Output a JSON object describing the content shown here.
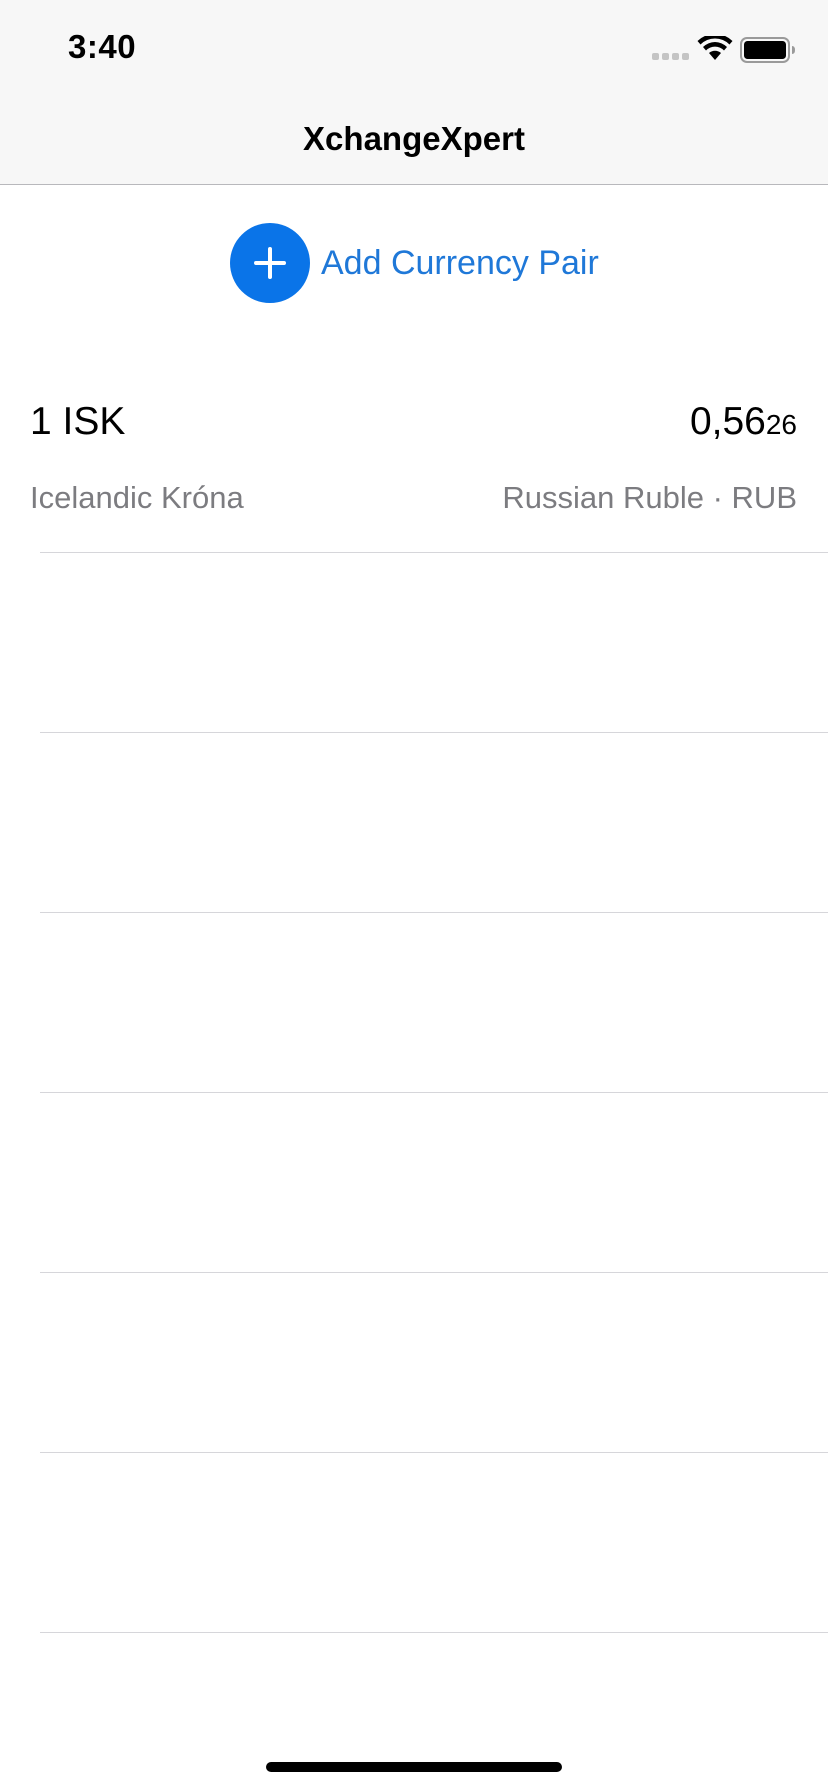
{
  "status_bar": {
    "time": "3:40",
    "icons": [
      "signal-icon",
      "wifi-icon",
      "battery-icon"
    ]
  },
  "nav": {
    "title": "XchangeXpert"
  },
  "add_pair": {
    "label": "Add Currency Pair",
    "icon": "plus-icon",
    "accent_color": "#0a74e8"
  },
  "pairs": [
    {
      "base_amount": "1 ISK",
      "base_name": "Icelandic Króna",
      "rate_main": "0,56",
      "rate_small": "26",
      "quote_label": "Russian Ruble · RUB"
    }
  ],
  "empty_rows": 6
}
